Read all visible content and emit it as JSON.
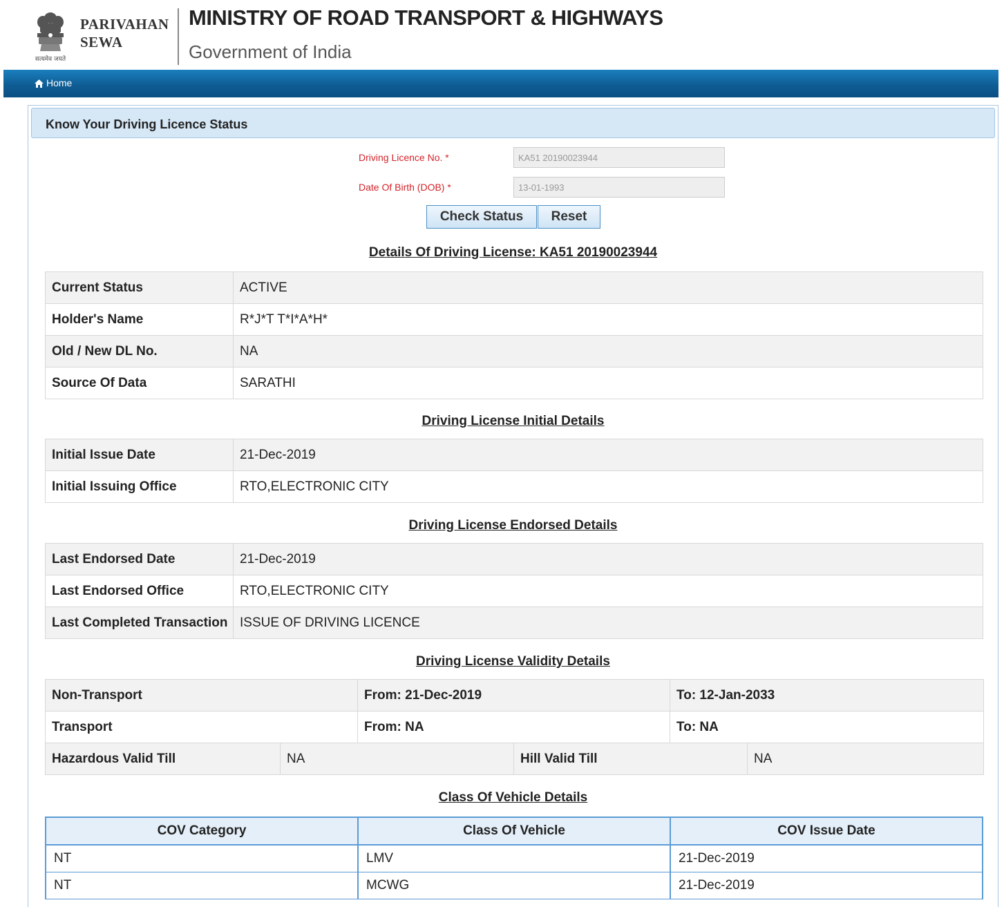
{
  "header": {
    "brand_line1": "PARIVAHAN",
    "brand_line2": "SEWA",
    "emblem_caption": "सत्यमेव जयते",
    "ministry": "MINISTRY OF ROAD TRANSPORT & HIGHWAYS",
    "government": "Government of India"
  },
  "nav": {
    "home": "Home"
  },
  "panel": {
    "title": "Know Your Driving Licence Status"
  },
  "form": {
    "dl_label": "Driving Licence No. *",
    "dl_value": "KA51 20190023944",
    "dob_label": "Date Of Birth (DOB) *",
    "dob_value": "13-01-1993",
    "check_button": "Check Status",
    "reset_button": "Reset"
  },
  "details": {
    "title": "Details Of Driving License: KA51 20190023944",
    "rows": [
      {
        "label": "Current Status",
        "value": "ACTIVE"
      },
      {
        "label": "Holder's Name",
        "value": "R*J*T T*I*A*H*"
      },
      {
        "label": "Old / New DL No.",
        "value": "NA"
      },
      {
        "label": "Source Of Data",
        "value": "SARATHI"
      }
    ]
  },
  "initial": {
    "title": "Driving License Initial Details",
    "rows": [
      {
        "label": "Initial Issue Date",
        "value": "21-Dec-2019"
      },
      {
        "label": "Initial Issuing Office",
        "value": "RTO,ELECTRONIC CITY"
      }
    ]
  },
  "endorsed": {
    "title": "Driving License Endorsed Details",
    "rows": [
      {
        "label": "Last Endorsed Date",
        "value": "21-Dec-2019"
      },
      {
        "label": "Last Endorsed Office",
        "value": "RTO,ELECTRONIC CITY"
      },
      {
        "label": "Last Completed Transaction",
        "value": "ISSUE OF DRIVING LICENCE"
      }
    ]
  },
  "validity": {
    "title": "Driving License Validity Details",
    "non_transport": {
      "label": "Non-Transport",
      "from": "From: 21-Dec-2019",
      "to": "To: 12-Jan-2033"
    },
    "transport": {
      "label": "Transport",
      "from": "From: NA",
      "to": "To: NA"
    },
    "hazardous_label": "Hazardous Valid Till",
    "hazardous_value": "NA",
    "hill_label": "Hill Valid Till",
    "hill_value": "NA"
  },
  "cov": {
    "title": "Class Of Vehicle Details",
    "headers": [
      "COV Category",
      "Class Of Vehicle",
      "COV Issue Date"
    ],
    "rows": [
      [
        "NT",
        "LMV",
        "21-Dec-2019"
      ],
      [
        "NT",
        "MCWG",
        "21-Dec-2019"
      ]
    ]
  }
}
